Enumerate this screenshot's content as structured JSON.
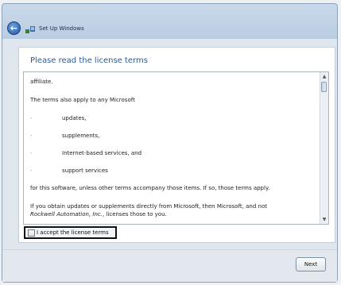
{
  "window": {
    "title": "Set Up Windows"
  },
  "heading": "Please read the license terms",
  "license": {
    "lines": [
      "affiliate.",
      "The terms also apply to any Microsoft",
      "updates,",
      "supplements,",
      "Internet-based services, and",
      "support services",
      "for this software, unless other terms accompany those items. If so, those terms apply.",
      "If you obtain updates or supplements directly from Microsoft, then Microsoft, and not",
      "Rockwell Automation, Inc.",
      ", licenses those to you."
    ],
    "bullet": "-"
  },
  "accept": {
    "label": "I accept the license terms",
    "checked": false
  },
  "buttons": {
    "next": "Next"
  },
  "icons": {
    "back": "back-arrow-icon",
    "setup": "setup-windows-icon",
    "scroll_up": "scroll-up-icon",
    "scroll_down": "scroll-down-icon"
  }
}
